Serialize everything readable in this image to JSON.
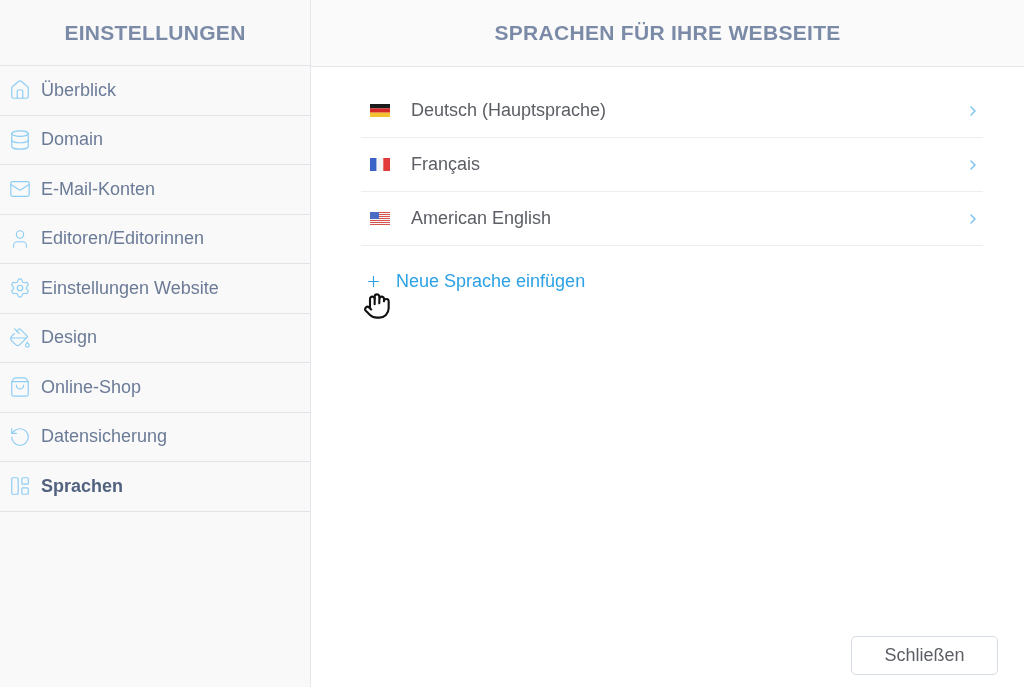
{
  "sidebar": {
    "title": "EINSTELLUNGEN",
    "items": [
      {
        "label": "Überblick",
        "selected": false
      },
      {
        "label": "Domain",
        "selected": false
      },
      {
        "label": "E-Mail-Konten",
        "selected": false
      },
      {
        "label": "Editoren/Editorinnen",
        "selected": false
      },
      {
        "label": "Einstellungen Website",
        "selected": false
      },
      {
        "label": "Design",
        "selected": false
      },
      {
        "label": "Online-Shop",
        "selected": false
      },
      {
        "label": "Datensicherung",
        "selected": false
      },
      {
        "label": "Sprachen",
        "selected": true
      }
    ]
  },
  "main": {
    "title": "SPRACHEN FÜR IHRE WEBSEITE",
    "languages": [
      {
        "label": "Deutsch (Hauptsprache)"
      },
      {
        "label": "Français"
      },
      {
        "label": "American English"
      }
    ],
    "add_link": {
      "label": "Neue Sprache einfügen"
    },
    "close_button": {
      "label": "Schließen"
    }
  }
}
